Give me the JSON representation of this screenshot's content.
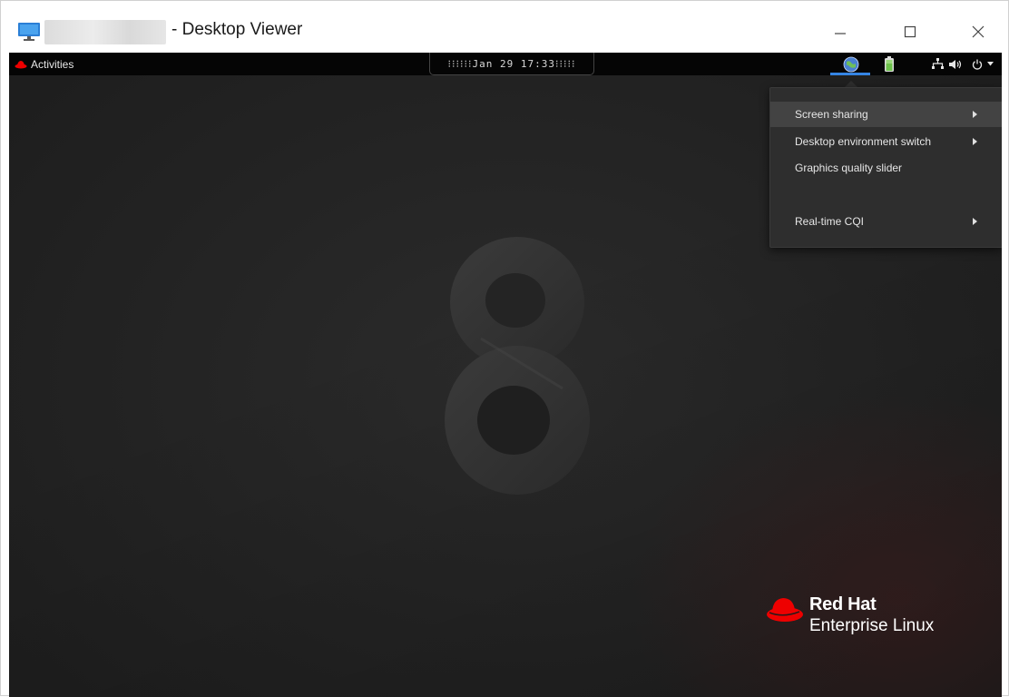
{
  "window": {
    "title": "- Desktop Viewer",
    "controls": {
      "minimize": "—",
      "maximize": "☐",
      "close": "✕"
    }
  },
  "topbar": {
    "activities_label": "Activities",
    "clock_text": "⁝⁝⁝⁝⁝⁝Jan 29  17:33⁝⁝⁝⁝⁝",
    "tray_icons": [
      "citrix-globe-icon",
      "battery-icon",
      "network-icon",
      "volume-icon",
      "power-icon",
      "chevron-down-icon"
    ]
  },
  "menu": {
    "items": [
      {
        "label": "Screen sharing",
        "has_submenu": true,
        "highlighted": true
      },
      {
        "label": "Desktop environment switch",
        "has_submenu": true,
        "highlighted": false
      },
      {
        "label": "Graphics quality slider",
        "has_submenu": false,
        "highlighted": false
      },
      {
        "label": "Real-time CQI",
        "has_submenu": true,
        "highlighted": false
      }
    ]
  },
  "branding": {
    "line1": "Red Hat",
    "line2": "Enterprise Linux"
  },
  "colors": {
    "accent_blue": "#3584e4",
    "redhat_red": "#ee0000",
    "topbar": "#050505",
    "menu_bg": "#2e2e2e",
    "menu_highlight": "#434343"
  }
}
